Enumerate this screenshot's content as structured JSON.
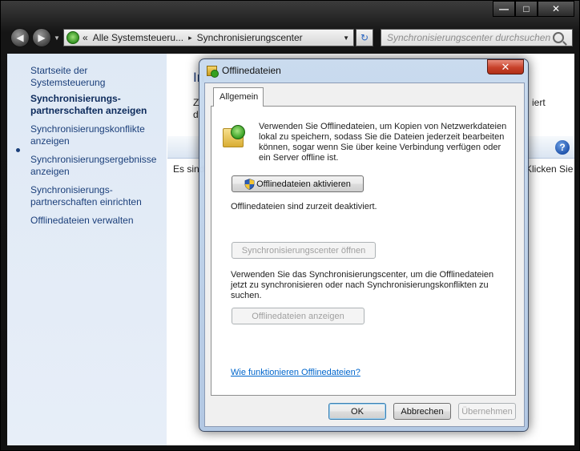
{
  "window": {
    "caption_buttons": {
      "minimize": "—",
      "maximize": "□",
      "close": "✕"
    }
  },
  "address_bar": {
    "path_prefix": "«",
    "crumbs": [
      "Alle Systemsteueru...",
      "Synchronisierungscenter"
    ],
    "crumb_separator": "▸",
    "search_placeholder": "Synchronisierungscenter durchsuchen"
  },
  "sidebar": {
    "items": [
      {
        "label": "Startseite der Systemsteuerung"
      },
      {
        "label": "Synchronisierungs-partnerschaften anzeigen",
        "active": true
      },
      {
        "label": "Synchronisierungskonflikte anzeigen"
      },
      {
        "label": "Synchronisierungsergebnisse anzeigen"
      },
      {
        "label": "Synchronisierungs-partnerschaften einrichten"
      },
      {
        "label": "Offlinedateien verwalten"
      }
    ]
  },
  "main": {
    "title_fragment": "In",
    "text_fragment_1": "Z",
    "text_fragment_2": "d",
    "text_fragment_right": "iert",
    "row_left": "Es sind",
    "row_right": "Klicken Sie",
    "help_label": "?"
  },
  "dialog": {
    "title": "Offlinedateien",
    "close_label": "✕",
    "tab_label": "Allgemein",
    "description": "Verwenden Sie Offlinedateien, um Kopien von Netzwerkdateien lokal zu speichern, sodass Sie die Dateien jederzeit bearbeiten können, sogar wenn Sie über keine Verbindung verfügen oder ein Server offline ist.",
    "activate_button": "Offlinedateien aktivieren",
    "status": "Offlinedateien sind zurzeit deaktiviert.",
    "open_sync_center_button": "Synchronisierungscenter öffnen",
    "sync_description": "Verwenden Sie das Synchronisierungscenter, um die Offlinedateien jetzt zu synchronisieren oder nach Synchronisierungskonflikten zu suchen.",
    "view_files_button": "Offlinedateien anzeigen",
    "help_link": "Wie funktionieren Offlinedateien?",
    "ok_button": "OK",
    "cancel_button": "Abbrechen",
    "apply_button": "Übernehmen"
  },
  "colors": {
    "link": "#0066cc",
    "sidebar_bg": "#dfe9f5",
    "close_red": "#c7412a"
  }
}
